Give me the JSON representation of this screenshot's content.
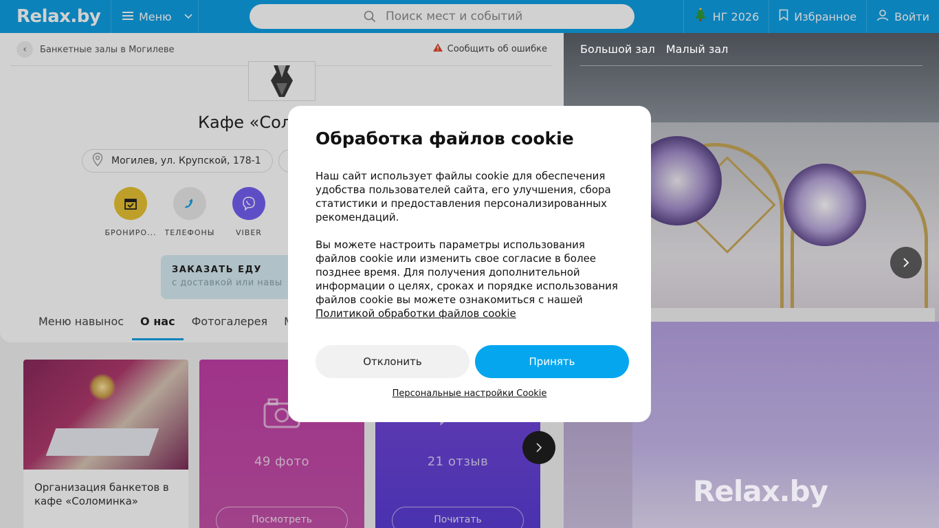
{
  "header": {
    "logo": "Relax.by",
    "menu_label": "Меню",
    "search_placeholder": "Поиск мест и событий",
    "ny_label": "НГ 2026",
    "favorites_label": "Избранное",
    "login_label": "Войти"
  },
  "breadcrumb": {
    "back_label": "Банкетные залы в Могилеве"
  },
  "report": {
    "label": "Сообщить об ошибке"
  },
  "place": {
    "title": "Кафе «Сол",
    "address": "Могилев, ул. Крупской, 178-1"
  },
  "actions": [
    {
      "label": "БРОНИРО...",
      "icon": "calendar-check-icon",
      "color": "#e8c232"
    },
    {
      "label": "ТЕЛЕФОНЫ",
      "icon": "phone-icon",
      "color": "#e9e9e9"
    },
    {
      "label": "VIBER",
      "icon": "viber-icon",
      "color": "#7360f2"
    }
  ],
  "food_banner": {
    "title": "ЗАКАЗАТЬ ЕДУ",
    "subtitle": "с доставкой или навы"
  },
  "tabs": [
    {
      "label": "Меню навынос",
      "active": false
    },
    {
      "label": "О нас",
      "active": true
    },
    {
      "label": "Фотогалерея",
      "active": false
    },
    {
      "label": "Ме",
      "active": false
    }
  ],
  "cards": {
    "banquet_caption": "Организация банкетов в кафе «Соломинка»",
    "photos_count": "49 фото",
    "photos_button": "Посмотреть",
    "reviews_count": "21 отзыв",
    "reviews_button": "Почитать"
  },
  "gallery": {
    "tabs": [
      "Большой зал",
      "Малый зал"
    ],
    "watermark": "Relax.by"
  },
  "cookie_modal": {
    "title": "Обработка файлов cookie",
    "paragraph1": "Наш сайт использует файлы cookie для обеспечения удобства пользователей сайта, его улучшения, сбора статистики и предоставления персонализированных рекомендаций.",
    "paragraph2": "Вы можете настроить параметры использования файлов cookie или изменить свое согласие в более позднее время. Для получения дополнительной информации о целях, сроках и порядке использования файлов cookie вы можете ознакомиться с нашей",
    "policy_link": "Политикой обработки файлов cookie",
    "decline_label": "Отклонить",
    "accept_label": "Принять",
    "personal_settings_label": "Персональные настройки Cookie"
  },
  "colors": {
    "brand": "#0f9fe3",
    "accept": "#05a6ee",
    "photos_card": "#c33fa8",
    "reviews_card": "#6a44d8"
  }
}
